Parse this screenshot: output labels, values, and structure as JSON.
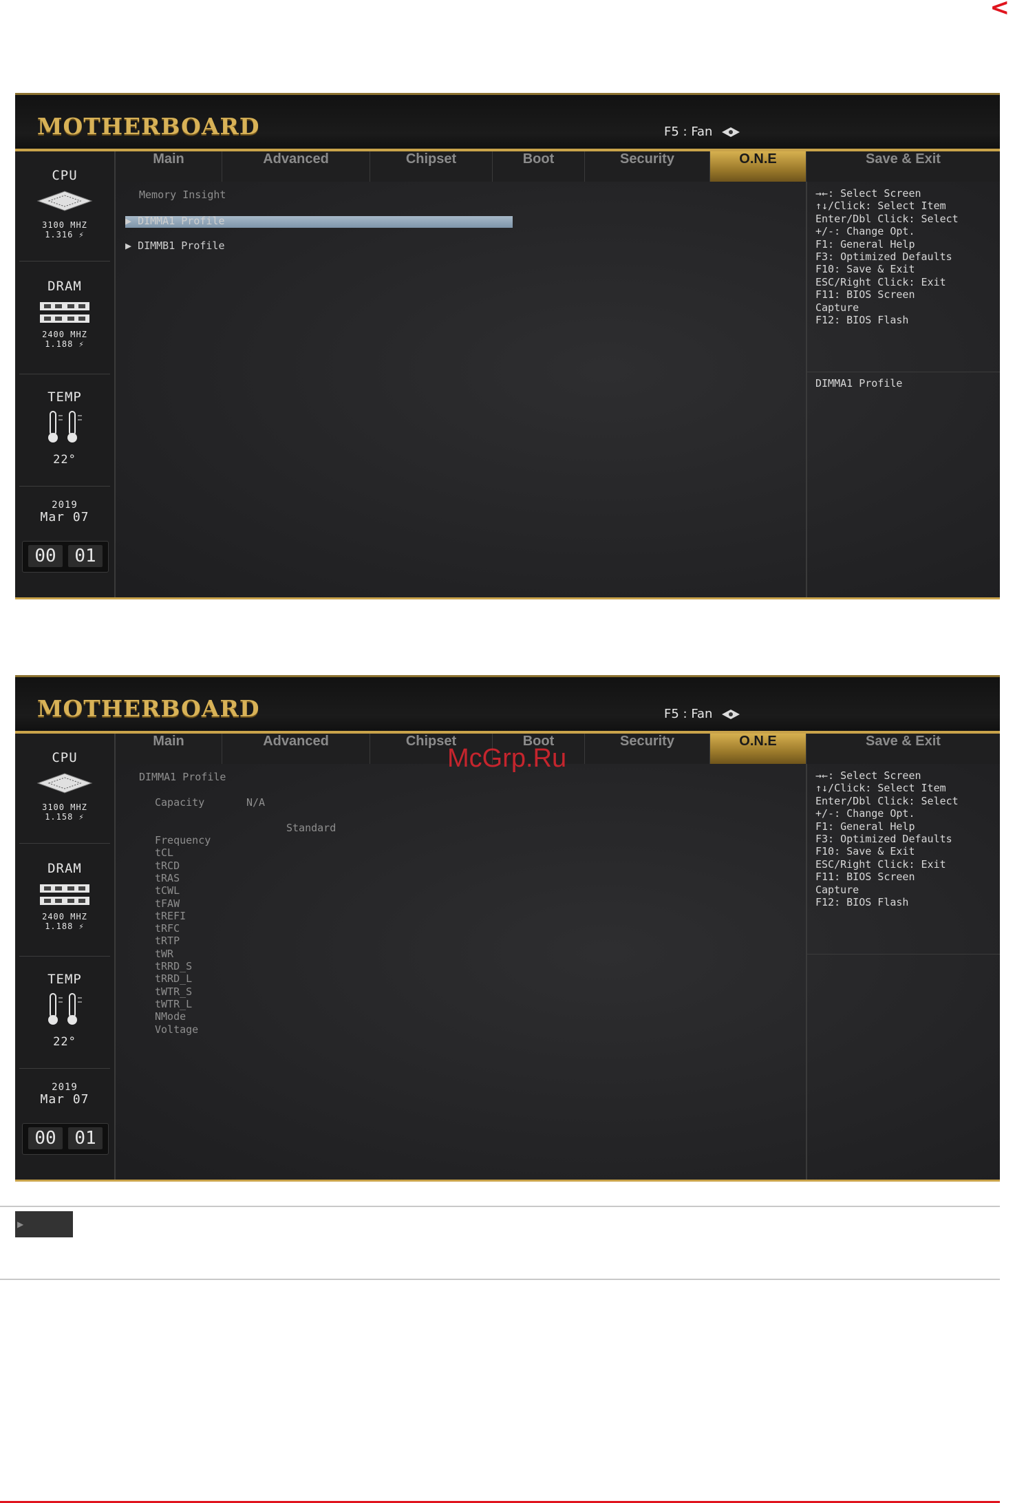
{
  "brand": "MOTHERBOARD",
  "fan_label": "F5 : Fan",
  "tabs": [
    "Main",
    "Advanced",
    "Chipset",
    "Boot",
    "Security",
    "O.N.E",
    "Save & Exit"
  ],
  "active_tab": "O.N.E",
  "sidebar_labels": {
    "cpu": "CPU",
    "dram": "DRAM",
    "temp": "TEMP"
  },
  "screen1": {
    "cpu_freq": "3100 MHZ",
    "cpu_volt": "1.316",
    "dram_freq": "2400 MHZ",
    "dram_volt": "1.188",
    "temp": "22",
    "year": "2019",
    "date": "Mar 07",
    "clock_h": "00",
    "clock_m": "01",
    "section_title": "Memory Insight",
    "items": [
      "DIMMA1 Profile",
      "DIMMB1 Profile"
    ],
    "help_desc": "DIMMA1 Profile"
  },
  "screen2": {
    "cpu_freq": "3100 MHZ",
    "cpu_volt": "1.158",
    "dram_freq": "2400 MHZ",
    "dram_volt": "1.188",
    "temp": "22",
    "year": "2019",
    "date": "Mar 07",
    "clock_h": "00",
    "clock_m": "01",
    "section_title": "DIMMA1 Profile",
    "capacity_label": "Capacity",
    "capacity_value": "N/A",
    "column_header": "Standard",
    "timings": [
      "Frequency",
      "tCL",
      "tRCD",
      "tRAS",
      "tCWL",
      "tFAW",
      "tREFI",
      "tRFC",
      "tRTP",
      "tWR",
      "tRRD_S",
      "tRRD_L",
      "tWTR_S",
      "tWTR_L",
      "NMode",
      "Voltage"
    ]
  },
  "help_keys": [
    "→←: Select Screen",
    "↑↓/Click: Select Item",
    "Enter/Dbl Click: Select",
    "+/-: Change Opt.",
    "F1: General Help",
    "F3: Optimized Defaults",
    "F10: Save & Exit",
    "ESC/Right Click: Exit",
    "F11: BIOS Screen",
    "Capture",
    "F12: BIOS Flash"
  ],
  "watermark": "McGrp.Ru",
  "corner_glyph": "<",
  "colors": {
    "accent_gold": "#c9a34a",
    "highlight": "#8fa6ba",
    "watermark_red": "#d8262f"
  }
}
